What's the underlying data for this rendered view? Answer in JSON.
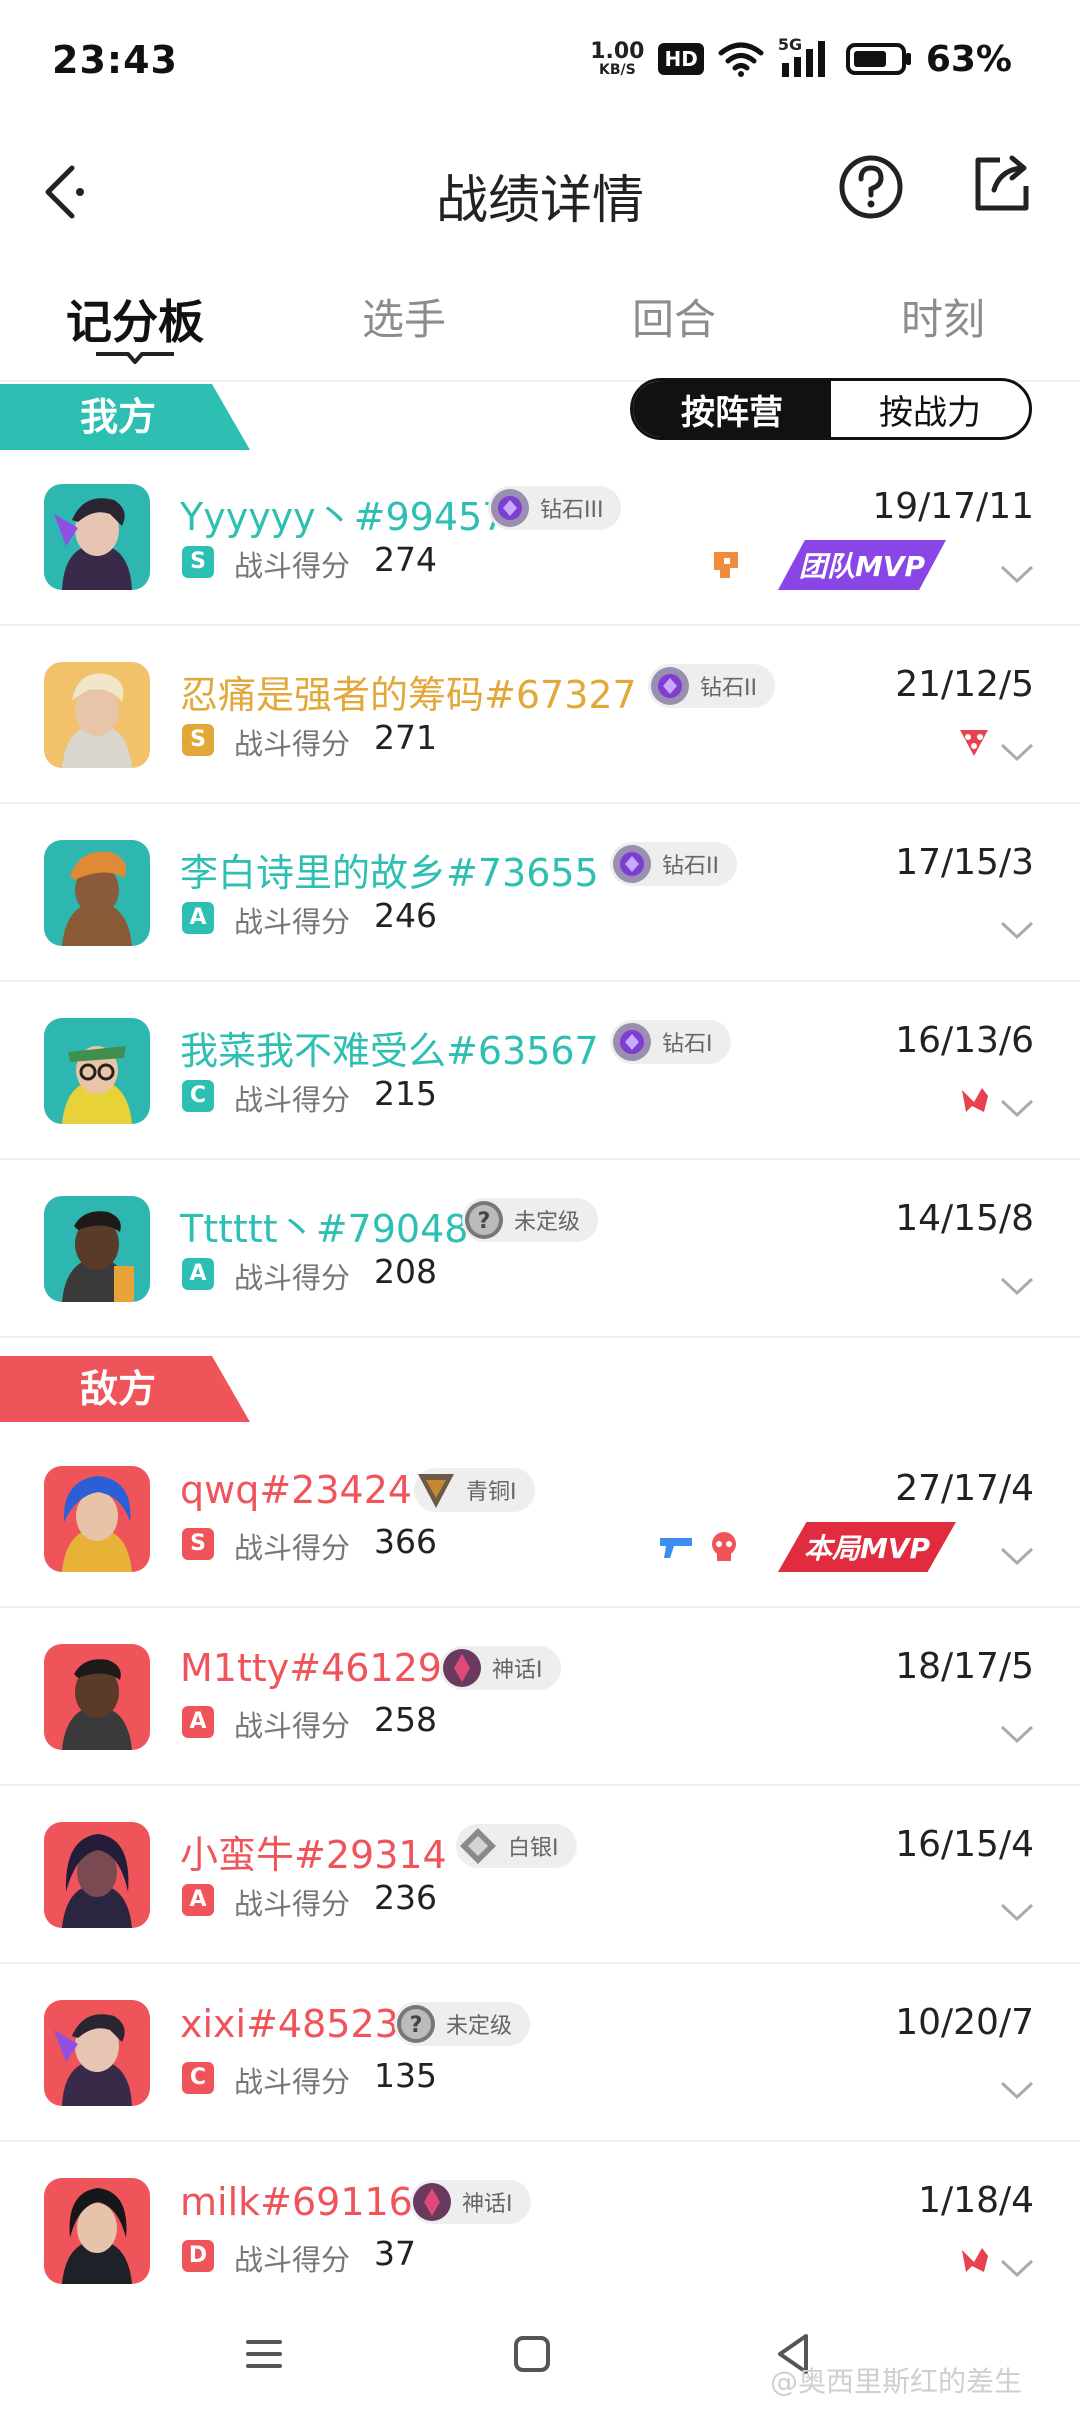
{
  "status_bar": {
    "time": "23:43",
    "speed_value": "1.00",
    "speed_unit": "KB/S",
    "hd": "HD",
    "network": "5G",
    "battery": "63%"
  },
  "header": {
    "title": "战绩详情",
    "back_icon": "back-arrow-icon",
    "help_icon": "help-circle-icon",
    "share_icon": "share-icon"
  },
  "tabs": [
    {
      "label": "记分板",
      "active": true
    },
    {
      "label": "选手",
      "active": false
    },
    {
      "label": "回合",
      "active": false
    },
    {
      "label": "时刻",
      "active": false
    }
  ],
  "teams": {
    "ours": {
      "label": "我方",
      "sort_toggle": {
        "options": [
          "按阵营",
          "按战力"
        ],
        "selected": "按阵营"
      },
      "players": [
        {
          "name": "Yyyyyy丶#99457",
          "rank": "钻石III",
          "grade": "S",
          "score_label": "战斗得分",
          "score": "274",
          "kda": "19/17/11",
          "badge": "团队MVP"
        },
        {
          "name": "忍痛是强者的筹码#67327",
          "rank": "钻石II",
          "grade": "S",
          "score_label": "战斗得分",
          "score": "271",
          "kda": "21/12/5"
        },
        {
          "name": "李白诗里的故乡#73655",
          "rank": "钻石II",
          "grade": "A",
          "score_label": "战斗得分",
          "score": "246",
          "kda": "17/15/3"
        },
        {
          "name": "我菜我不难受么#63567",
          "rank": "钻石I",
          "grade": "C",
          "score_label": "战斗得分",
          "score": "215",
          "kda": "16/13/6"
        },
        {
          "name": "Tttttt丶#79048",
          "rank": "未定级",
          "grade": "A",
          "score_label": "战斗得分",
          "score": "208",
          "kda": "14/15/8"
        }
      ]
    },
    "enemy": {
      "label": "敌方",
      "players": [
        {
          "name": "qwq#23424",
          "rank": "青铜I",
          "grade": "S",
          "score_label": "战斗得分",
          "score": "366",
          "kda": "27/17/4",
          "badge": "本局MVP"
        },
        {
          "name": "M1tty#46129",
          "rank": "神话I",
          "grade": "A",
          "score_label": "战斗得分",
          "score": "258",
          "kda": "18/17/5"
        },
        {
          "name": "小蛮牛#29314",
          "rank": "白银I",
          "grade": "A",
          "score_label": "战斗得分",
          "score": "236",
          "kda": "16/15/4"
        },
        {
          "name": "xixi#48523",
          "rank": "未定级",
          "grade": "C",
          "score_label": "战斗得分",
          "score": "135",
          "kda": "10/20/7"
        },
        {
          "name": "milk#69116",
          "rank": "神话I",
          "grade": "D",
          "score_label": "战斗得分",
          "score": "37",
          "kda": "1/18/4"
        }
      ]
    }
  },
  "colors": {
    "ours_accent": "#2ebfb3",
    "ours_gold": "#e3a83a",
    "enemy_accent": "#ee545a",
    "team_mvp": "#8a45e6",
    "match_mvp": "#e12b3e"
  },
  "watermark": "@奥西里斯红的差生"
}
